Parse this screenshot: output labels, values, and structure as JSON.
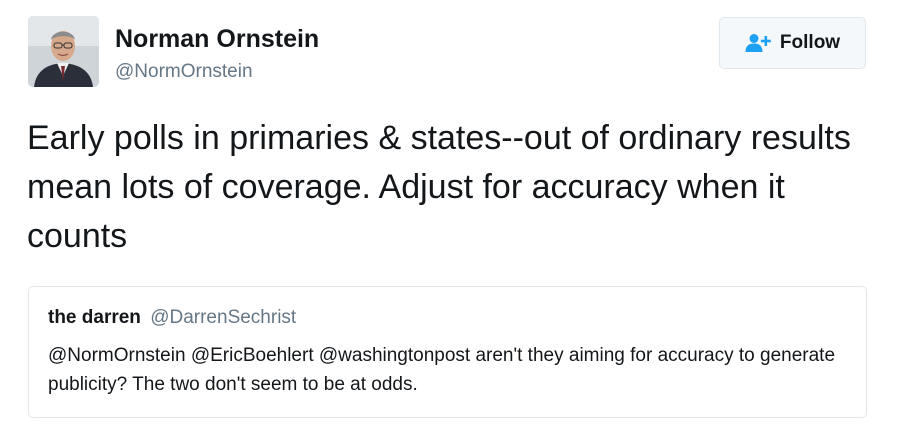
{
  "author": {
    "name": "Norman Ornstein",
    "handle": "@NormOrnstein",
    "avatar_icon": "profile-photo-icon"
  },
  "follow_button": {
    "label": "Follow",
    "icon": "add-user-icon",
    "icon_color": "#1da1f2"
  },
  "tweet": {
    "text": "Early polls in primaries & states--out of ordinary results mean lots of coverage. Adjust for accuracy when it counts"
  },
  "quoted_tweet": {
    "name": "the darren",
    "handle": "@DarrenSechrist",
    "text": "@NormOrnstein @EricBoehlert @washingtonpost aren't they aiming for accuracy to generate publicity? The two don't seem to be at odds."
  },
  "colors": {
    "text": "#14171a",
    "secondary_text": "#657786",
    "border": "#e1e8ed",
    "accent": "#1da1f2"
  }
}
